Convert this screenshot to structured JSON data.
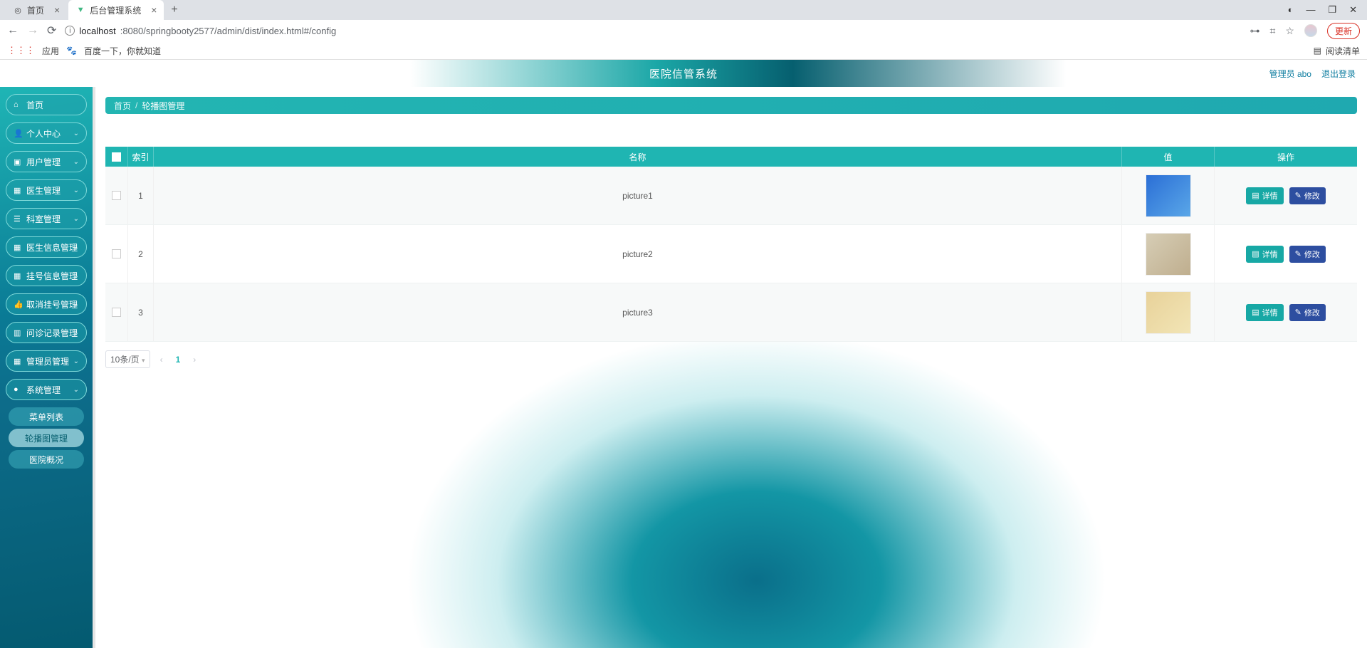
{
  "browser": {
    "tabs": [
      {
        "label": "首页",
        "active": false
      },
      {
        "label": "后台管理系统",
        "active": true
      }
    ],
    "url_host": "localhost",
    "url_path": ":8080/springbooty2577/admin/dist/index.html#/config",
    "apps_label": "应用",
    "bookmark_label": "百度一下，你就知道",
    "reading_list": "阅读清单",
    "update_label": "更新"
  },
  "header": {
    "title": "医院信管系统",
    "admin_label": "管理员 abo",
    "logout_label": "退出登录"
  },
  "sidebar": {
    "items": [
      {
        "icon": "home",
        "label": "首页",
        "expandable": false
      },
      {
        "icon": "user",
        "label": "个人中心",
        "expandable": true
      },
      {
        "icon": "chat",
        "label": "用户管理",
        "expandable": true
      },
      {
        "icon": "grid",
        "label": "医生管理",
        "expandable": true
      },
      {
        "icon": "list",
        "label": "科室管理",
        "expandable": true
      },
      {
        "icon": "grid",
        "label": "医生信息管理",
        "expandable": true
      },
      {
        "icon": "grid",
        "label": "挂号信息管理",
        "expandable": true
      },
      {
        "icon": "thumb",
        "label": "取消挂号管理",
        "expandable": true
      },
      {
        "icon": "building",
        "label": "问诊记录管理",
        "expandable": true
      },
      {
        "icon": "grid",
        "label": "管理员管理",
        "expandable": true
      },
      {
        "icon": "gear",
        "label": "系统管理",
        "expandable": true
      }
    ],
    "sub_items": [
      {
        "label": "菜单列表",
        "active": false
      },
      {
        "label": "轮播图管理",
        "active": true
      },
      {
        "label": "医院概况",
        "active": false
      }
    ]
  },
  "breadcrumb": {
    "home": "首页",
    "current": "轮播图管理"
  },
  "table": {
    "headers": {
      "index": "索引",
      "name": "名称",
      "value": "值",
      "ops": "操作"
    },
    "rows": [
      {
        "index": "1",
        "name": "picture1"
      },
      {
        "index": "2",
        "name": "picture2"
      },
      {
        "index": "3",
        "name": "picture3"
      }
    ],
    "btn_detail": "详情",
    "btn_edit": "修改"
  },
  "pagination": {
    "size_label": "10条/页",
    "current": "1"
  }
}
